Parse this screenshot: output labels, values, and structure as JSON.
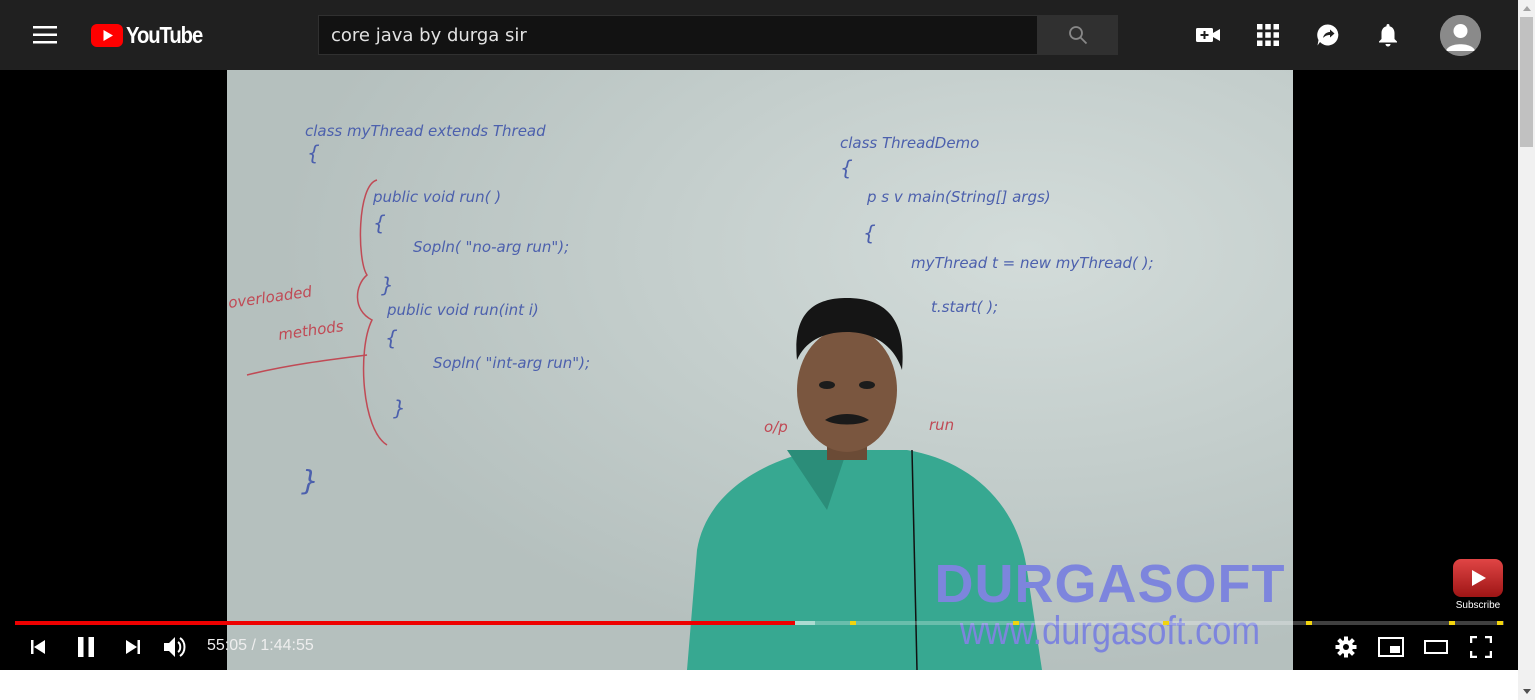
{
  "masthead": {
    "logo_text": "YouTube",
    "search": {
      "value": "core java by durga sir",
      "placeholder": "Search"
    },
    "icons": [
      "menu-icon",
      "create-video-icon",
      "apps-icon",
      "messages-icon",
      "notifications-icon",
      "account-avatar"
    ]
  },
  "player": {
    "watermark": {
      "brand": "DURGASOFT",
      "url": "www.durgasoft.com"
    },
    "subscribe_label": "Subscribe",
    "current_time": "55:05",
    "separator": " / ",
    "duration": "1:44:55",
    "progress_played_fraction": 0.524,
    "progress_loaded_fraction": 0.537,
    "chapter_markers": [
      0.563,
      0.672,
      0.773,
      0.869,
      0.965,
      0.997
    ],
    "colors": {
      "played": "#ee0000",
      "chapter": "#f2d40e",
      "logo_red": "#ff0000"
    }
  },
  "whiteboard": {
    "left_code": [
      "class myThread extends Thread",
      "{",
      "public void run( )",
      "{",
      "Sopln( \"no-arg run\");",
      "}",
      "public void run(int i)",
      "{",
      "Sopln( \"int-arg run\");",
      "}",
      "}"
    ],
    "left_note": [
      "overloaded",
      "methods"
    ],
    "right_code": [
      "class ThreadDemo",
      "{",
      "p s v main(String[] args)",
      "{",
      "myThread t = new myThread( );",
      "t.start( );"
    ],
    "output_note": [
      "o/p",
      "run"
    ]
  }
}
